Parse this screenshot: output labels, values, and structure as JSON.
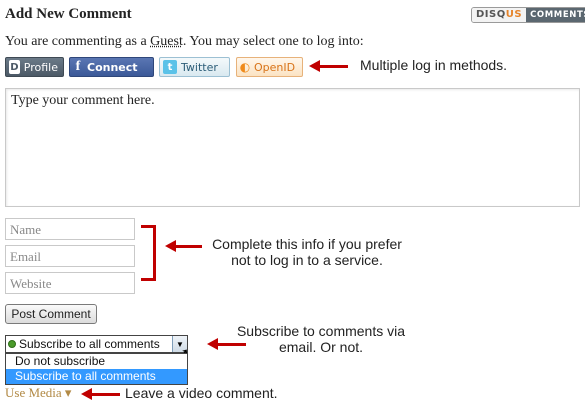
{
  "header": {
    "title": "Add New Comment",
    "badge_brand_disq": "DISQ",
    "badge_brand_us": "US",
    "badge_comments": "COMMENTS"
  },
  "intro": {
    "before": "You are commenting as a ",
    "guest": "Guest",
    "after": ". You may select one to log into:"
  },
  "login_buttons": [
    {
      "label": "Profile",
      "icon": "disqus-icon"
    },
    {
      "label": "Connect",
      "icon": "facebook-icon"
    },
    {
      "label": "Twitter",
      "icon": "twitter-icon"
    },
    {
      "label": "OpenID",
      "icon": "openid-icon"
    }
  ],
  "comment_box": {
    "placeholder": "Type your comment here."
  },
  "fields": {
    "name": "Name",
    "email": "Email",
    "website": "Website"
  },
  "post_button": "Post Comment",
  "subscribe": {
    "selected": "Subscribe to all comments",
    "options": [
      "Do not subscribe",
      "Subscribe to all comments"
    ]
  },
  "use_media": "Use Media ▾",
  "annotations": {
    "login": "Multiple log in methods.",
    "info_line1": "Complete this info if you prefer",
    "info_line2": "not to log in to a service.",
    "subscribe_line1": "Subscribe to comments via",
    "subscribe_line2": "email. Or not.",
    "media": "Leave a video comment."
  },
  "colors": {
    "annotation_arrow": "#c00000",
    "selected_option": "#3399ff",
    "media_link": "#b28a46"
  }
}
